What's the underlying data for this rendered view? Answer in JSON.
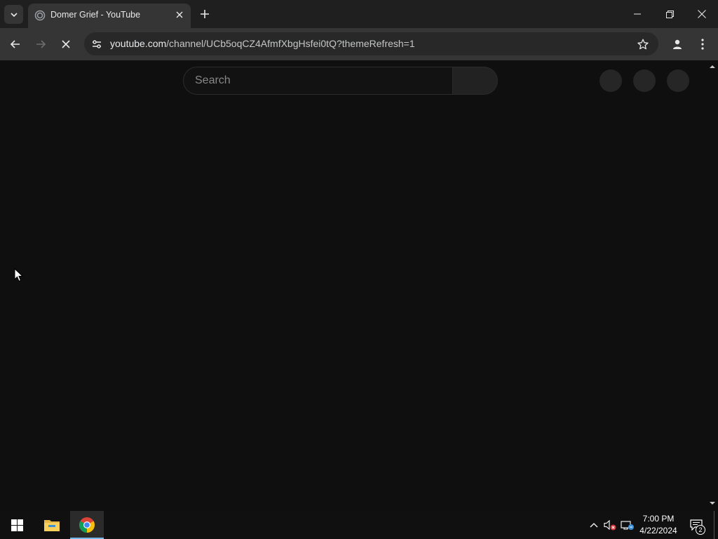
{
  "browser": {
    "tab": {
      "title": "Domer Grief - YouTube"
    },
    "address_bar": {
      "host": "youtube.com",
      "path": "/channel/UCb5oqCZ4AfmfXbgHsfei0tQ?themeRefresh=1"
    },
    "window_controls": [
      "minimize-icon",
      "restore-icon",
      "close-icon"
    ]
  },
  "youtube": {
    "search": {
      "placeholder": "Search",
      "value": ""
    }
  },
  "taskbar": {
    "clock": {
      "time": "7:00 PM",
      "date": "4/22/2024"
    },
    "notification_count": "2",
    "accent_color": "#76b9ed"
  },
  "colors": {
    "page_bg": "#0f0f0f",
    "toolbar_bg": "#353535",
    "tabstrip_bg": "#1f1f1f"
  }
}
